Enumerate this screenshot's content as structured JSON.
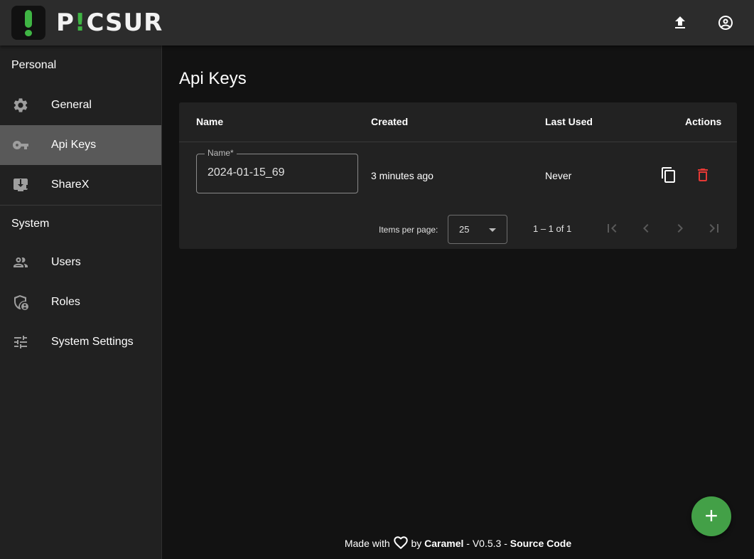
{
  "app": {
    "name_prefix": "P",
    "name_bang": "!",
    "name_suffix": "CSUR",
    "accent_color": "#3fb544"
  },
  "topbar": {
    "upload_icon": "upload-icon",
    "account_icon": "account-circle-icon"
  },
  "sidebar": {
    "sections": [
      {
        "header": "Personal",
        "items": [
          {
            "label": "General",
            "icon": "gear-icon"
          },
          {
            "label": "Api Keys",
            "icon": "key-icon",
            "active": true
          },
          {
            "label": "ShareX",
            "icon": "monitor-download-icon"
          }
        ]
      },
      {
        "header": "System",
        "items": [
          {
            "label": "Users",
            "icon": "users-icon"
          },
          {
            "label": "Roles",
            "icon": "shield-account-icon"
          },
          {
            "label": "System Settings",
            "icon": "tune-icon"
          }
        ]
      }
    ]
  },
  "main": {
    "title": "Api Keys",
    "table": {
      "columns": [
        "Name",
        "Created",
        "Last Used",
        "Actions"
      ],
      "rows": [
        {
          "name_label": "Name*",
          "name_value": "2024-01-15_69",
          "created": "3 minutes ago",
          "last_used": "Never"
        }
      ]
    },
    "paginator": {
      "items_per_page_label": "Items per page:",
      "page_size": "25",
      "range": "1 – 1 of 1"
    }
  },
  "footer": {
    "made_with": "Made with",
    "by": "by",
    "author": "Caramel",
    "version": "- V0.5.3 -",
    "source": "Source Code"
  },
  "fab": {
    "label": "+",
    "color": "#43a047"
  },
  "colors": {
    "delete": "#e53935"
  }
}
